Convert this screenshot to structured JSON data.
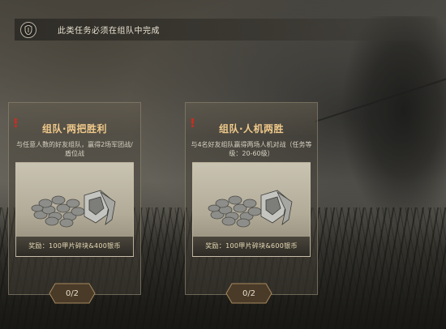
{
  "banner": {
    "icon": "shield-sword-icon",
    "text": "此类任务必须在组队中完成"
  },
  "quests": [
    {
      "title": "组队·两把胜利",
      "description": "与任意人数的好友组队，赢得2场军团战/盾位战",
      "reward_icon": "coins-and-armor-shards-icon",
      "reward": "奖励：100甲片碎块&400银币",
      "progress": "0/2"
    },
    {
      "title": "组队·人机两胜",
      "description": "与4名好友组队赢得两场人机对战（任务等级：20-60级）",
      "reward_icon": "coins-and-armor-shards-icon",
      "reward": "奖励：100甲片碎块&600银币",
      "progress": "0/2"
    }
  ],
  "colors": {
    "title": "#f0c98a",
    "alert": "#d12a1f",
    "text": "#e8e2d2"
  }
}
